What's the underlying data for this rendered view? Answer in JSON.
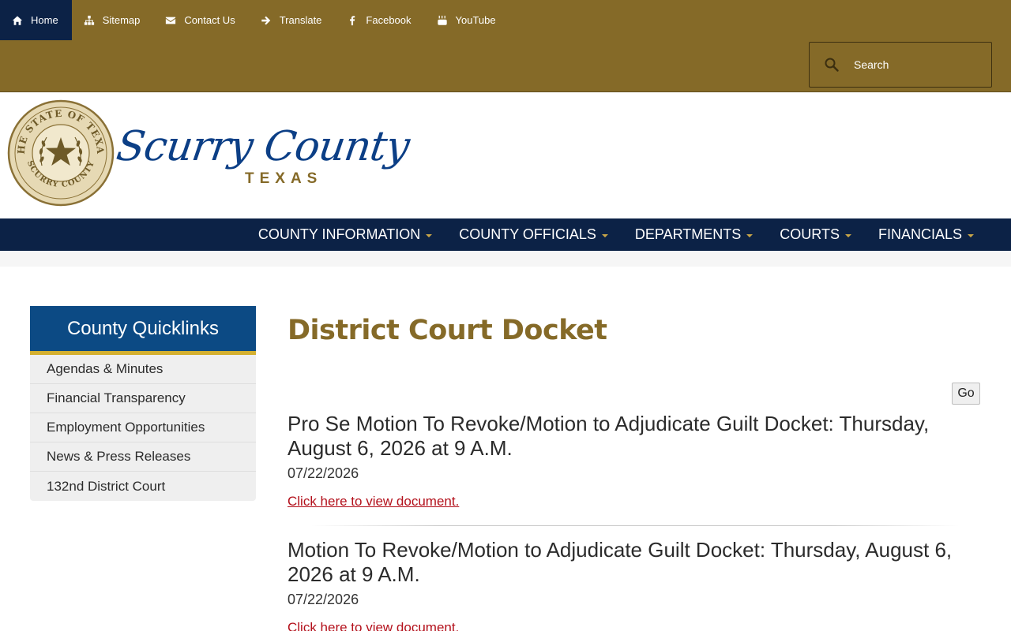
{
  "utility_nav": [
    {
      "label": "Home",
      "icon": "home-icon",
      "active": true
    },
    {
      "label": "Sitemap",
      "icon": "sitemap-icon"
    },
    {
      "label": "Contact Us",
      "icon": "envelope-icon"
    },
    {
      "label": "Translate",
      "icon": "arrow-right-icon"
    },
    {
      "label": "Facebook",
      "icon": "facebook-icon"
    },
    {
      "label": "YouTube",
      "icon": "youtube-icon"
    }
  ],
  "search": {
    "placeholder": "Search"
  },
  "logo": {
    "seal_top": "THE STATE OF TEXAS",
    "seal_bottom": "SCURRY COUNTY",
    "script": "Scurry County",
    "sub": "TEXAS"
  },
  "main_nav": [
    {
      "label": "COUNTY INFORMATION"
    },
    {
      "label": "COUNTY OFFICIALS"
    },
    {
      "label": "DEPARTMENTS"
    },
    {
      "label": "COURTS"
    },
    {
      "label": "FINANCIALS"
    }
  ],
  "sidebar": {
    "title": "County Quicklinks",
    "items": [
      {
        "label": "Agendas & Minutes"
      },
      {
        "label": "Financial Transparency"
      },
      {
        "label": "Employment Opportunities"
      },
      {
        "label": "News & Press Releases"
      },
      {
        "label": "132nd District Court"
      }
    ]
  },
  "content": {
    "title": "District Court Docket",
    "go_label": "Go",
    "posts": [
      {
        "title": "Pro Se Motion To Revoke/Motion to Adjudicate Guilt Docket: Thursday, August 6, 2026 at 9 A.M.",
        "date": "07/22/2026",
        "link": "Click here to view document."
      },
      {
        "title": "Motion To Revoke/Motion to Adjudicate Guilt Docket: Thursday, August 6, 2026 at 9 A.M.",
        "date": "07/22/2026",
        "link": "Click here to view document."
      }
    ]
  },
  "colors": {
    "gold": "#856a28",
    "navy": "#0c2246",
    "quicklinks_blue": "#0c4a84",
    "accent_yellow": "#d4b030",
    "link_red": "#b3101b"
  }
}
